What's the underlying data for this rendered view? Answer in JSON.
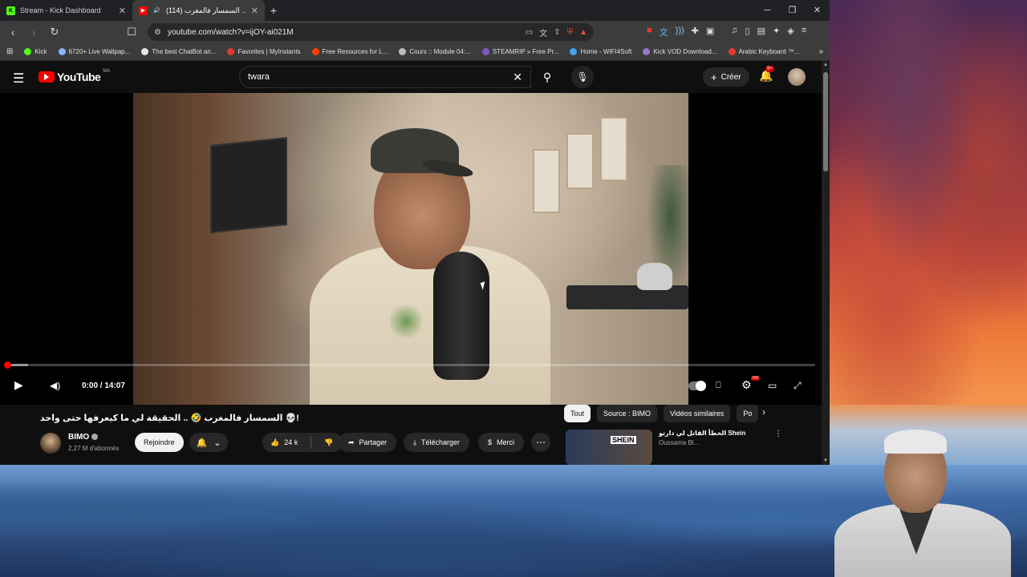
{
  "tabs": [
    {
      "label": "Stream - Kick Dashboard",
      "favicon_color": "#53fc18",
      "favicon_glyph": "K",
      "active": false
    },
    {
      "label": "(114) السمسار فالمغرب ..",
      "favicon_color": "#ff0000",
      "favicon_glyph": "▶",
      "active": true
    }
  ],
  "address": {
    "url": "youtube.com/watch?v=ijOY-ai021M"
  },
  "bookmarks": [
    {
      "label": "Kick",
      "color": "#53fc18"
    },
    {
      "label": "6720+ Live Wallpap...",
      "color": "#8ab4f8"
    },
    {
      "label": "The best ChatBot an...",
      "color": "#e8e8e8"
    },
    {
      "label": "Favorites | MyInstants",
      "color": "#e53935"
    },
    {
      "label": "Free Resources for L...",
      "color": "#ff3d00"
    },
    {
      "label": "Cours :: Module 04:...",
      "color": "#bdbdbd"
    },
    {
      "label": "STEAMRIP » Free Pr...",
      "color": "#7e57c2"
    },
    {
      "label": "Home - WIFI4Soft",
      "color": "#42a5f5"
    },
    {
      "label": "Kick VOD Download...",
      "color": "#9575cd"
    },
    {
      "label": "Arabic Keyboard ™...",
      "color": "#e53935"
    }
  ],
  "youtube": {
    "logo_text": "YouTube",
    "country_code": "MA",
    "search_value": "twara",
    "create_label": "Créer",
    "notification_badge": "9+",
    "player": {
      "time": "0:00 / 14:07",
      "played_fraction": 0.0,
      "buffered_fraction": 0.027,
      "settings_badge": "HD"
    },
    "video": {
      "title": "السمسار فالمغرب 🤣 .. الحقيقة لي ما كيعرفها حتى واحد 💀!",
      "channel": "BIMO",
      "subscribers": "2,27 M d'abonnés",
      "join_label": "Rejoindre",
      "likes": "24 k",
      "share_label": "Partager",
      "download_label": "Télécharger",
      "thanks_label": "Merci"
    },
    "chips": [
      "Tout",
      "Source : BIMO",
      "Vidéos similaires",
      "Po"
    ],
    "recommendation": {
      "title": "الخطأ القاتل لي دارتو Shein",
      "channel": "Oussama Bl...",
      "thumb_text": "SHEIN"
    }
  }
}
